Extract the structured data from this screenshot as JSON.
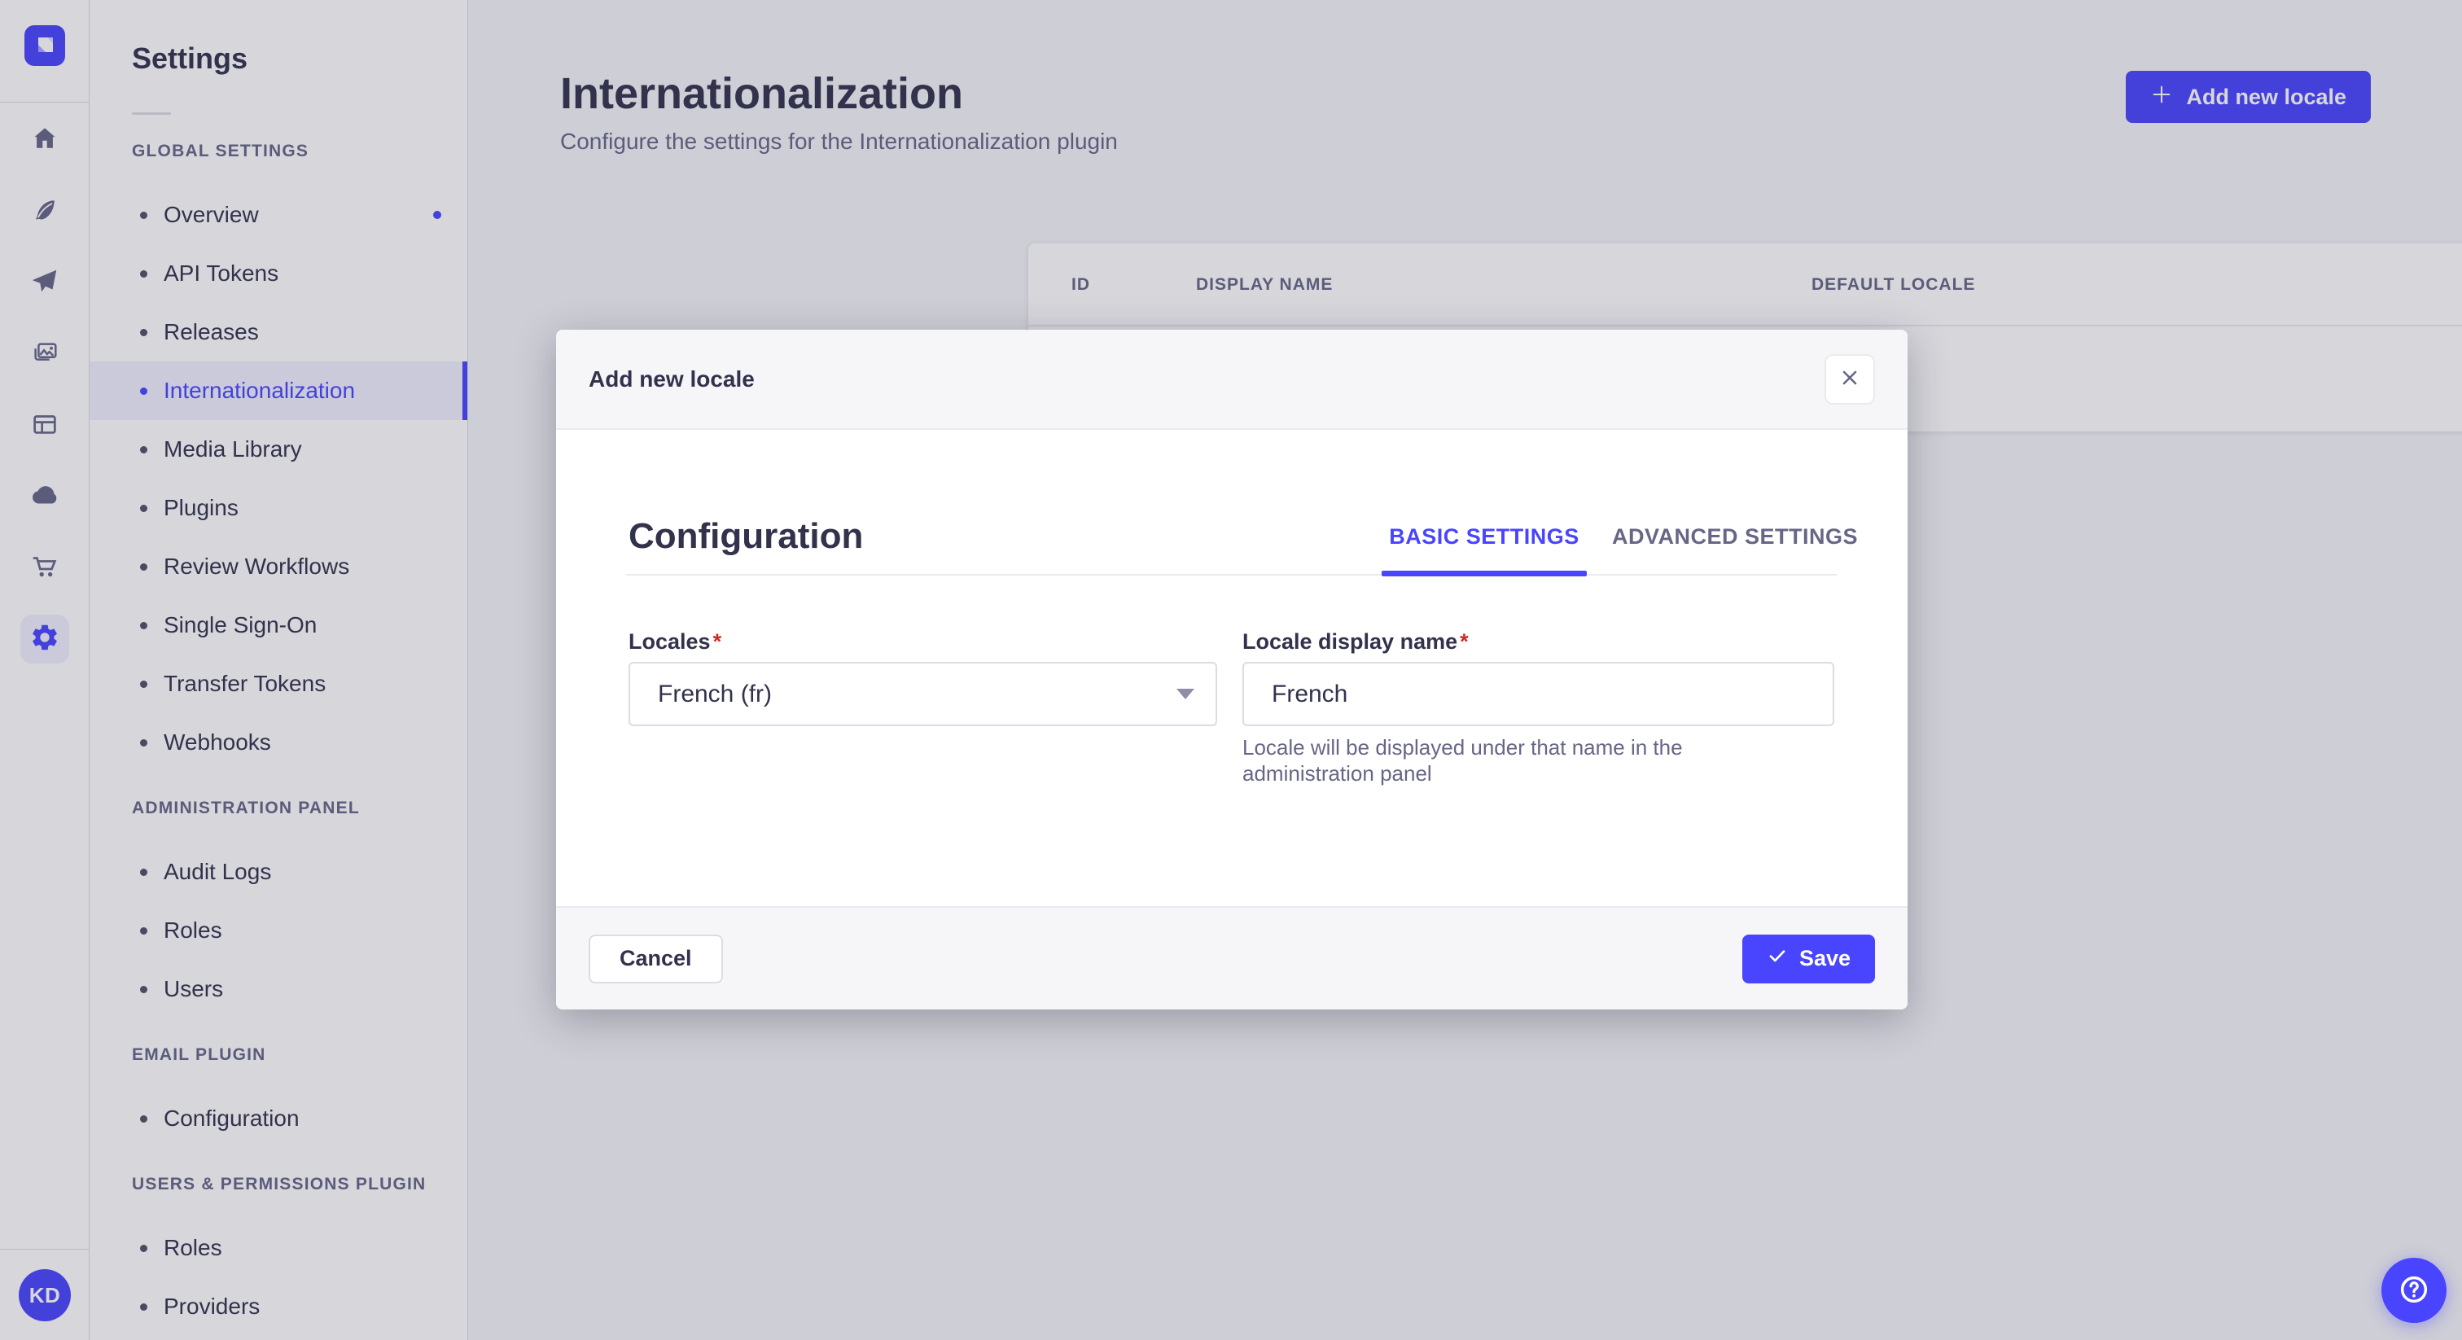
{
  "colors": {
    "accent": "#4945ff",
    "accent_light": "#f0f0ff",
    "text_dark": "#32324d",
    "text_muted": "#666687",
    "danger": "#d02b20",
    "border": "#dcdce4"
  },
  "rail": {
    "logo_icon": "strapi-logo",
    "icons": [
      "home-icon",
      "feather-icon",
      "paper-plane-icon",
      "media-library-icon",
      "layout-icon",
      "cloud-icon",
      "cart-icon",
      "gear-icon"
    ],
    "active_icon": "gear-icon",
    "avatar_initials": "KD"
  },
  "sidebar": {
    "title": "Settings",
    "groups": [
      {
        "label": "GLOBAL SETTINGS",
        "items": [
          {
            "label": "Overview",
            "has_notification_dot": true
          },
          {
            "label": "API Tokens"
          },
          {
            "label": "Releases"
          },
          {
            "label": "Internationalization",
            "active": true
          },
          {
            "label": "Media Library"
          },
          {
            "label": "Plugins"
          },
          {
            "label": "Review Workflows"
          },
          {
            "label": "Single Sign-On"
          },
          {
            "label": "Transfer Tokens"
          },
          {
            "label": "Webhooks"
          }
        ]
      },
      {
        "label": "ADMINISTRATION PANEL",
        "items": [
          {
            "label": "Audit Logs"
          },
          {
            "label": "Roles"
          },
          {
            "label": "Users"
          }
        ]
      },
      {
        "label": "EMAIL PLUGIN",
        "items": [
          {
            "label": "Configuration"
          }
        ]
      },
      {
        "label": "USERS & PERMISSIONS PLUGIN",
        "items": [
          {
            "label": "Roles"
          },
          {
            "label": "Providers"
          }
        ]
      }
    ]
  },
  "main": {
    "title": "Internationalization",
    "subtitle": "Configure the settings for the Internationalization plugin",
    "add_button_label": "Add new locale",
    "table": {
      "columns": [
        "ID",
        "DISPLAY NAME",
        "DEFAULT LOCALE"
      ],
      "row_action_icon": "pencil-icon"
    }
  },
  "modal": {
    "title": "Add new locale",
    "close_icon": "close-icon",
    "section_title": "Configuration",
    "tabs": [
      {
        "label": "BASIC SETTINGS",
        "active": true
      },
      {
        "label": "ADVANCED SETTINGS",
        "active": false
      }
    ],
    "required_mark": "*",
    "fields": {
      "locales": {
        "label": "Locales",
        "value": "French (fr)",
        "dropdown_icon": "chevron-down-icon"
      },
      "display_name": {
        "label": "Locale display name",
        "value": "French",
        "helper": "Locale will be displayed under that name in the administration panel"
      }
    },
    "cancel_label": "Cancel",
    "save_label": "Save",
    "save_icon": "check-icon"
  },
  "help_button_icon": "question-mark-icon"
}
